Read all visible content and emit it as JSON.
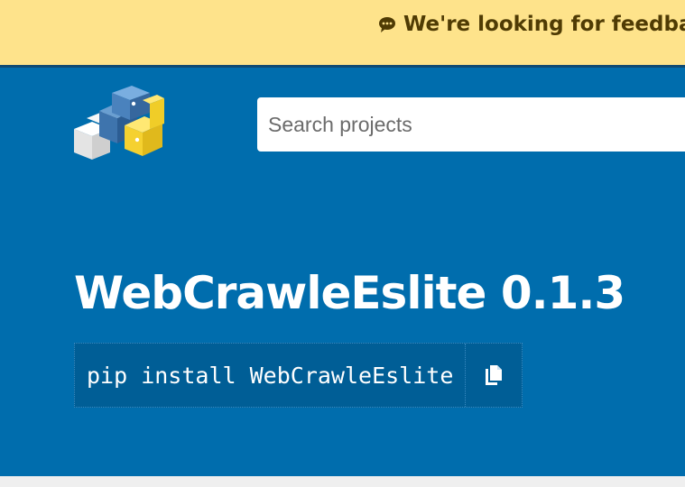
{
  "banner": {
    "icon": "chat-bubble-icon",
    "text": "We're looking for feedback",
    "bg_color": "#fee38b",
    "text_color": "#4f3b04"
  },
  "header": {
    "logo": "pypi-logo",
    "search": {
      "placeholder": "Search projects",
      "value": ""
    },
    "bg_color": "#006dad"
  },
  "package": {
    "title": "WebCrawleEslite 0.1.3",
    "pip_command": "pip install WebCrawleEslite",
    "copy_icon": "copy-icon"
  }
}
